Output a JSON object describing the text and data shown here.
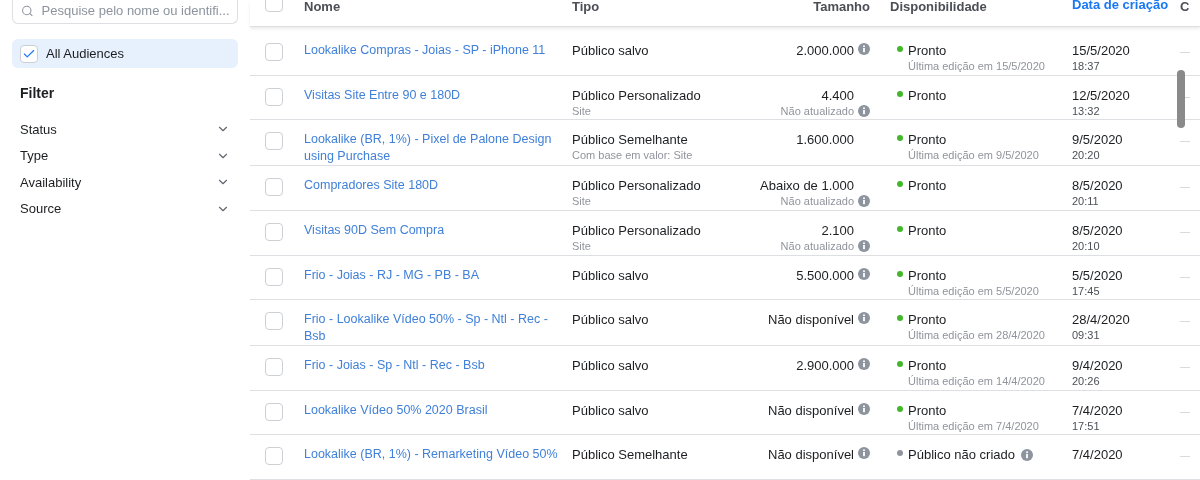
{
  "sidebar": {
    "search": {
      "placeholder": "Pesquise pelo nome ou identifi..."
    },
    "all_audiences": {
      "label": "All Audiences",
      "checked": true
    },
    "filter_title": "Filter",
    "filters": [
      {
        "label": "Status",
        "expanded": false
      },
      {
        "label": "Type",
        "expanded": false
      },
      {
        "label": "Availability",
        "expanded": false
      },
      {
        "label": "Source",
        "expanded": false
      }
    ]
  },
  "table": {
    "select_all": {
      "checked": false
    },
    "columns": [
      {
        "label": "Nome",
        "sorted": false
      },
      {
        "label": "Tipo",
        "sorted": false
      },
      {
        "label": "Tamanho",
        "sorted": false
      },
      {
        "label": "Disponibilidade",
        "sorted": false
      },
      {
        "label": "Data de criação",
        "sorted": true
      },
      {
        "label": "C",
        "sorted": false
      }
    ],
    "rows": [
      {
        "checked": false,
        "name": "Lookalike Compras - Joias - SP - iPhone 11",
        "type": "Público salvo",
        "size": "2.000.000",
        "size_info": true,
        "color": "#42b72a",
        "status": "Pronto",
        "status_info": false,
        "status_note": "Última edição em 15/5/2020",
        "date": "15/5/2020",
        "time": "18:37",
        "column_7": "—"
      },
      {
        "checked": false,
        "name": "Visitas Site Entre 90 e 180D",
        "type": "Público Personalizado",
        "type_note": "Site",
        "size": "4.400",
        "size_info": false,
        "size_note": "Não atualizado",
        "color": "#42b72a",
        "status": "Pronto",
        "status_info": false,
        "date": "12/5/2020",
        "time": "13:32",
        "column_7": "—"
      },
      {
        "checked": false,
        "name": "Lookalike (BR, 1%) - Pixel de Palone Design using Purchase",
        "type": "Público Semelhante",
        "type_note": "Com base em valor: Site",
        "size": "1.600.000",
        "size_info": false,
        "color": "#42b72a",
        "status": "Pronto",
        "status_info": false,
        "status_note": "Última edição em 9/5/2020",
        "date": "9/5/2020",
        "time": "20:20",
        "column_7": "—"
      },
      {
        "checked": false,
        "name": "Compradores Site 180D",
        "type": "Público Personalizado",
        "type_note": "Site",
        "size": "Abaixo de 1.000",
        "size_info": false,
        "size_note": "Não atualizado",
        "color": "#42b72a",
        "status": "Pronto",
        "status_info": false,
        "date": "8/5/2020",
        "time": "20:11",
        "column_7": "—"
      },
      {
        "checked": false,
        "name": "Visitas 90D Sem Compra",
        "type": "Público Personalizado",
        "type_note": "Site",
        "size": "2.100",
        "size_info": false,
        "size_note": "Não atualizado",
        "color": "#42b72a",
        "status": "Pronto",
        "status_info": false,
        "date": "8/5/2020",
        "time": "20:10",
        "column_7": "—"
      },
      {
        "checked": false,
        "name": "Frio - Joias - RJ - MG - PB - BA",
        "type": "Público salvo",
        "size": "5.500.000",
        "size_info": true,
        "color": "#42b72a",
        "status": "Pronto",
        "status_info": false,
        "status_note": "Última edição em 5/5/2020",
        "date": "5/5/2020",
        "time": "17:45",
        "column_7": "—"
      },
      {
        "checked": false,
        "name": "Frio - Lookalike Vídeo 50% - Sp - Ntl - Rec - Bsb",
        "type": "Público salvo",
        "size": "Não disponível",
        "size_info": true,
        "color": "#42b72a",
        "status": "Pronto",
        "status_info": false,
        "status_note": "Última edição em 28/4/2020",
        "date": "28/4/2020",
        "time": "09:31",
        "column_7": "—"
      },
      {
        "checked": false,
        "name": "Frio - Joias - Sp - Ntl - Rec - Bsb",
        "type": "Público salvo",
        "size": "2.900.000",
        "size_info": true,
        "color": "#42b72a",
        "status": "Pronto",
        "status_info": false,
        "status_note": "Última edição em 14/4/2020",
        "date": "9/4/2020",
        "time": "20:26",
        "column_7": "—"
      },
      {
        "checked": false,
        "name": "Lookalike Vídeo 50% 2020 Brasil",
        "type": "Público salvo",
        "size": "Não disponível",
        "size_info": true,
        "color": "#42b72a",
        "status": "Pronto",
        "status_info": false,
        "status_note": "Última edição em 7/4/2020",
        "date": "7/4/2020",
        "time": "17:51",
        "column_7": "—"
      },
      {
        "checked": false,
        "name": "Lookalike (BR, 1%) - Remarketing Vídeo 50%",
        "type": "Público Semelhante",
        "size": "Não disponível",
        "size_info": true,
        "color": "#90949c",
        "status": "Público não criado",
        "status_info": true,
        "date": "7/4/2020",
        "column_7": "—"
      }
    ]
  }
}
